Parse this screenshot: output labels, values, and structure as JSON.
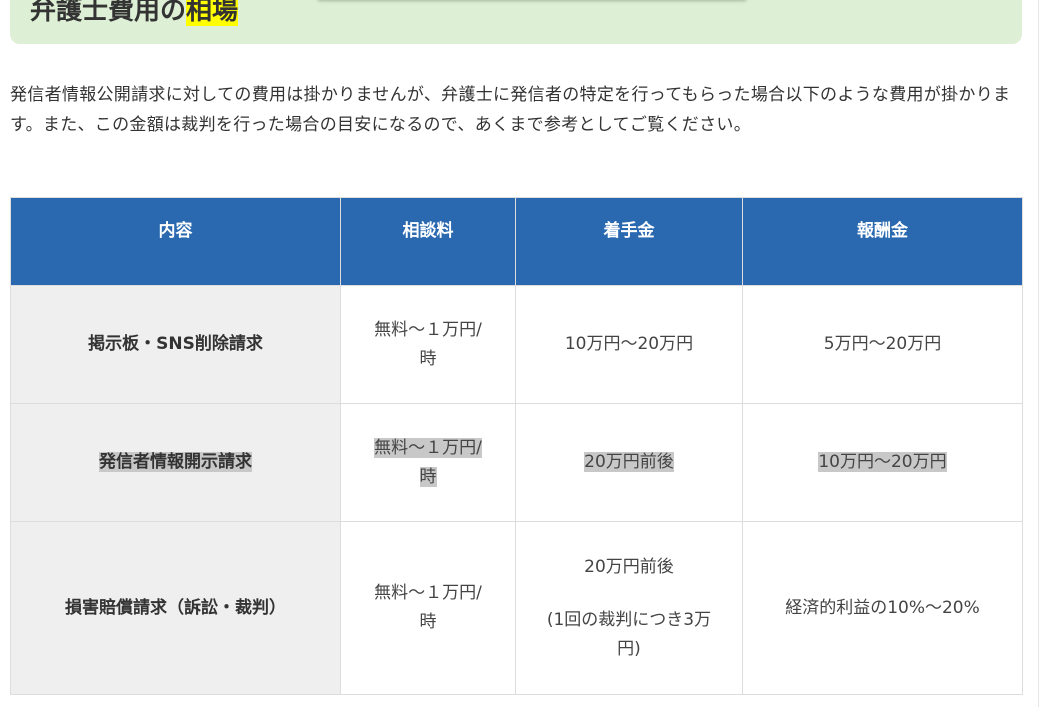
{
  "heading": {
    "text_plain": "弁護士費用の",
    "text_highlight": "相場"
  },
  "intro": "発信者情報公開請求に対しての費用は掛かりませんが、弁護士に発信者の特定を行ってもらった場合以下のような費用が掛かります。また、この金額は裁判を行った場合の目安になるので、あくまで参考としてご覧ください。",
  "table": {
    "headers": [
      "内容",
      "相談料",
      "着手金",
      "報酬金"
    ],
    "rows": [
      {
        "label": "掲示板・SNS削除請求",
        "consult_line1": "無料～１万円/",
        "consult_line2": "時",
        "retainer_line1": "10万円～20万円",
        "retainer_line2": "",
        "retainer_line3": "",
        "reward": "5万円～20万円"
      },
      {
        "label": "発信者情報開示請求",
        "consult_line1": "無料～１万円/",
        "consult_line2": "時",
        "retainer_line1": "20万円前後",
        "retainer_line2": "",
        "retainer_line3": "",
        "reward": "10万円～20万円"
      },
      {
        "label": "損害賠償請求（訴訟・裁判）",
        "consult_line1": "無料～１万円/",
        "consult_line2": "時",
        "retainer_line1": "20万円前後",
        "retainer_line2": "(1回の裁判につき3万",
        "retainer_line3": "円)",
        "reward": "経済的利益の10%～20%"
      }
    ]
  }
}
